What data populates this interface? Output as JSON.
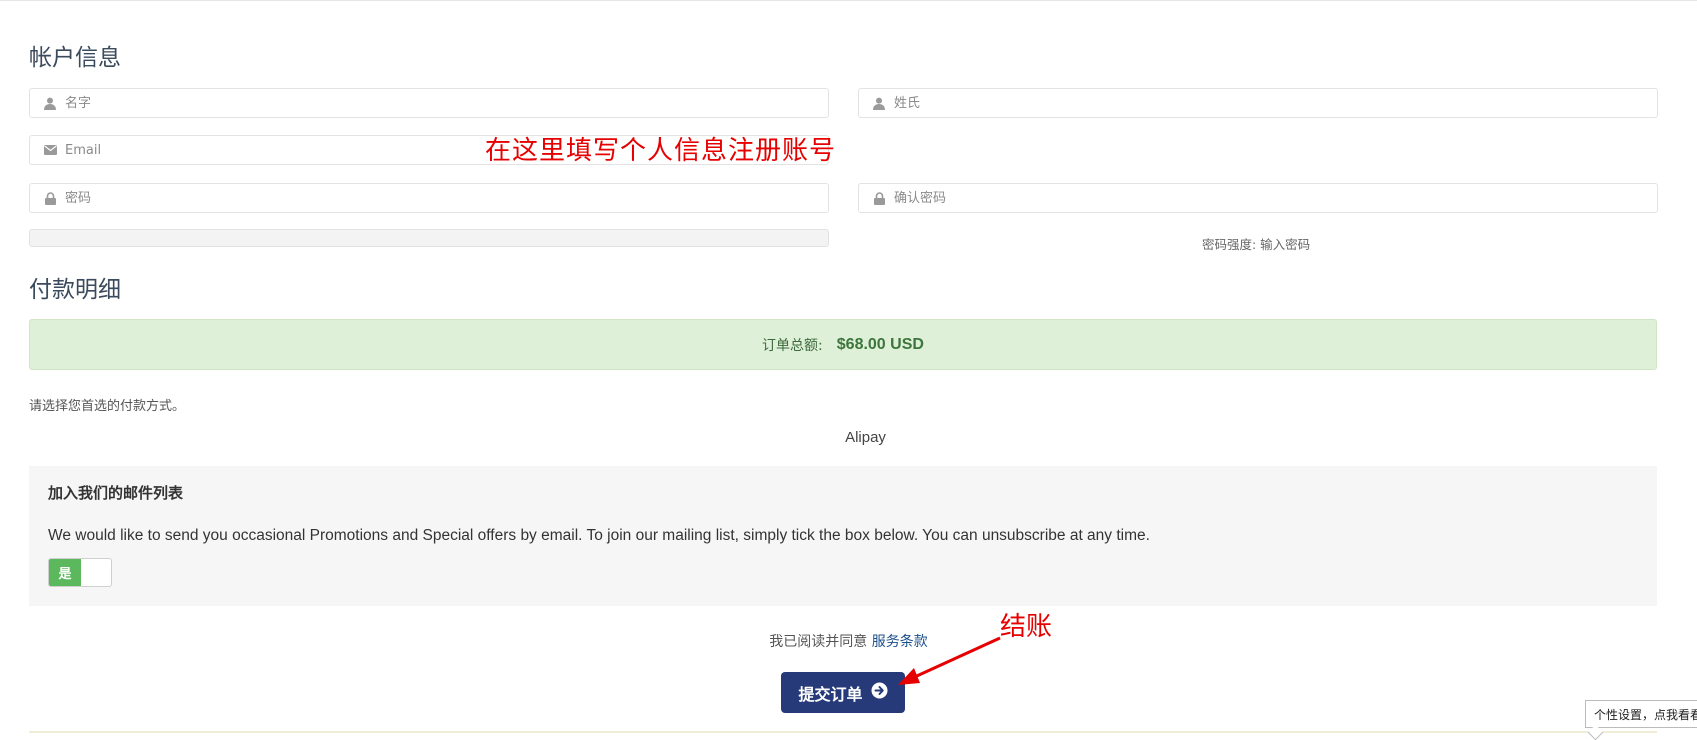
{
  "account": {
    "title": "帐户信息",
    "first_name_placeholder": "名字",
    "last_name_placeholder": "姓氏",
    "email_placeholder": "Email",
    "password_placeholder": "密码",
    "confirm_password_placeholder": "确认密码",
    "strength_text": "密码强度: 输入密码"
  },
  "payment": {
    "title": "付款明细",
    "total_label": "订单总额:",
    "total_amount": "$68.00 USD",
    "choose_note": "请选择您首选的付款方式。",
    "method": "Alipay"
  },
  "mailing": {
    "title": "加入我们的邮件列表",
    "text": "We would like to send you occasional Promotions and Special offers by email. To join our mailing list, simply tick the box below. You can unsubscribe at any time.",
    "toggle_label": "是"
  },
  "terms": {
    "prefix": "我已阅读并同意",
    "link": "服务条款"
  },
  "submit": {
    "label": "提交订单"
  },
  "annotations": {
    "main": "在这里填写个人信息注册账号",
    "checkout": "结账"
  },
  "tooltip": {
    "text": "个性设置，点我看看"
  },
  "colors": {
    "accent": "#263a7a",
    "success_bg": "#dff0d8",
    "toggle_on": "#5cb85c",
    "annotation": "#e60000"
  },
  "icons": {
    "user": "user-icon",
    "email": "envelope-icon",
    "password": "lock-icon",
    "submit": "arrow-circle-right-icon"
  }
}
